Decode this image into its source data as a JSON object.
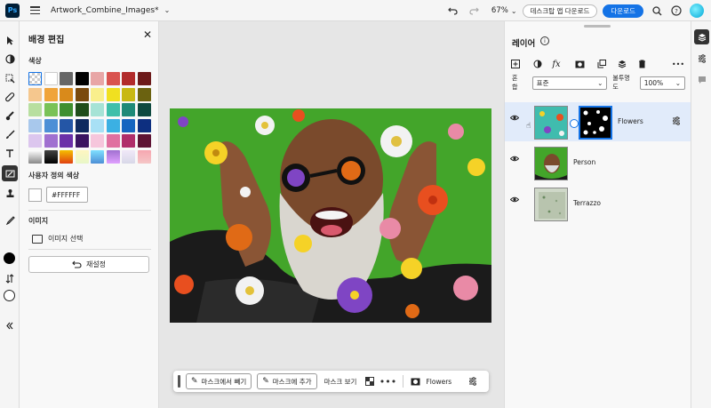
{
  "app": {
    "logo": "Ps",
    "doc_title": "Artwork_Combine_Images*",
    "zoom": "67%",
    "desktop_button": "데스크탑 앱 다운로드",
    "download_button": "다운로드"
  },
  "bg_panel": {
    "title": "배경 편집",
    "colors_label": "색상",
    "custom_label": "사용자 정의 색상",
    "hex_value": "#FFFFFF",
    "image_label": "이미지",
    "image_select": "이미지 선택",
    "reset": "재설정",
    "swatches": [
      "transparent",
      "#ffffff",
      "#666666",
      "#000000",
      "#e8a6a6",
      "#d9534f",
      "#b22b2b",
      "#6d1a1a",
      "#f5c78e",
      "#f0a43a",
      "#d98a1b",
      "#7a4a0e",
      "#f9ef8c",
      "#f0e020",
      "#c8b814",
      "#6b6210",
      "#b8dfa0",
      "#79c257",
      "#3f8f2f",
      "#1f4d1a",
      "#a6e3d6",
      "#3fbfaa",
      "#1e8a78",
      "#0f4a40",
      "#a8c8ec",
      "#4d8fd6",
      "#2456a6",
      "#0f2a5e",
      "#a8e0f5",
      "#3bb0e3",
      "#1565c0",
      "#0d2f80",
      "#dcc6ee",
      "#a070d0",
      "#6b30a8",
      "#3a1460",
      "#f6c6dc",
      "#e070a0",
      "#b02e6a",
      "#5e1334",
      "gray-gradient",
      "black-gradient",
      "orange-gradient",
      "yellow-gradient",
      "sky-gradient",
      "violet-gradient",
      "lavender-gradient",
      "pink-gradient"
    ]
  },
  "floatbar": {
    "subtract": "마스크에서 빼기",
    "add": "마스크에 추가",
    "view": "마스크 보기",
    "layer_name": "Flowers"
  },
  "layers_panel": {
    "title": "레이어",
    "blend_label": "혼합",
    "blend_value": "표준",
    "opacity_label": "불투명도",
    "opacity_value": "100%",
    "layers": [
      {
        "name": "Flowers",
        "selected": true
      },
      {
        "name": "Person",
        "selected": false
      },
      {
        "name": "Terrazzo",
        "selected": false
      }
    ]
  },
  "colors": {
    "accent": "#1473e6",
    "canvas_green": "#43a52a",
    "foreground": "#000000",
    "background": "#ffffff"
  },
  "icons": {
    "tools": [
      "select-arrow-icon",
      "adjust-icon",
      "quick-select-icon",
      "heal-icon",
      "brush-color-icon",
      "brush-icon",
      "text-icon",
      "bg-edit-icon",
      "clone-stamp-icon",
      "eyedropper-icon",
      "swap-colors-icon",
      "collapse-icon"
    ],
    "rail": [
      "layers-icon",
      "properties-icon",
      "comments-icon"
    ]
  }
}
